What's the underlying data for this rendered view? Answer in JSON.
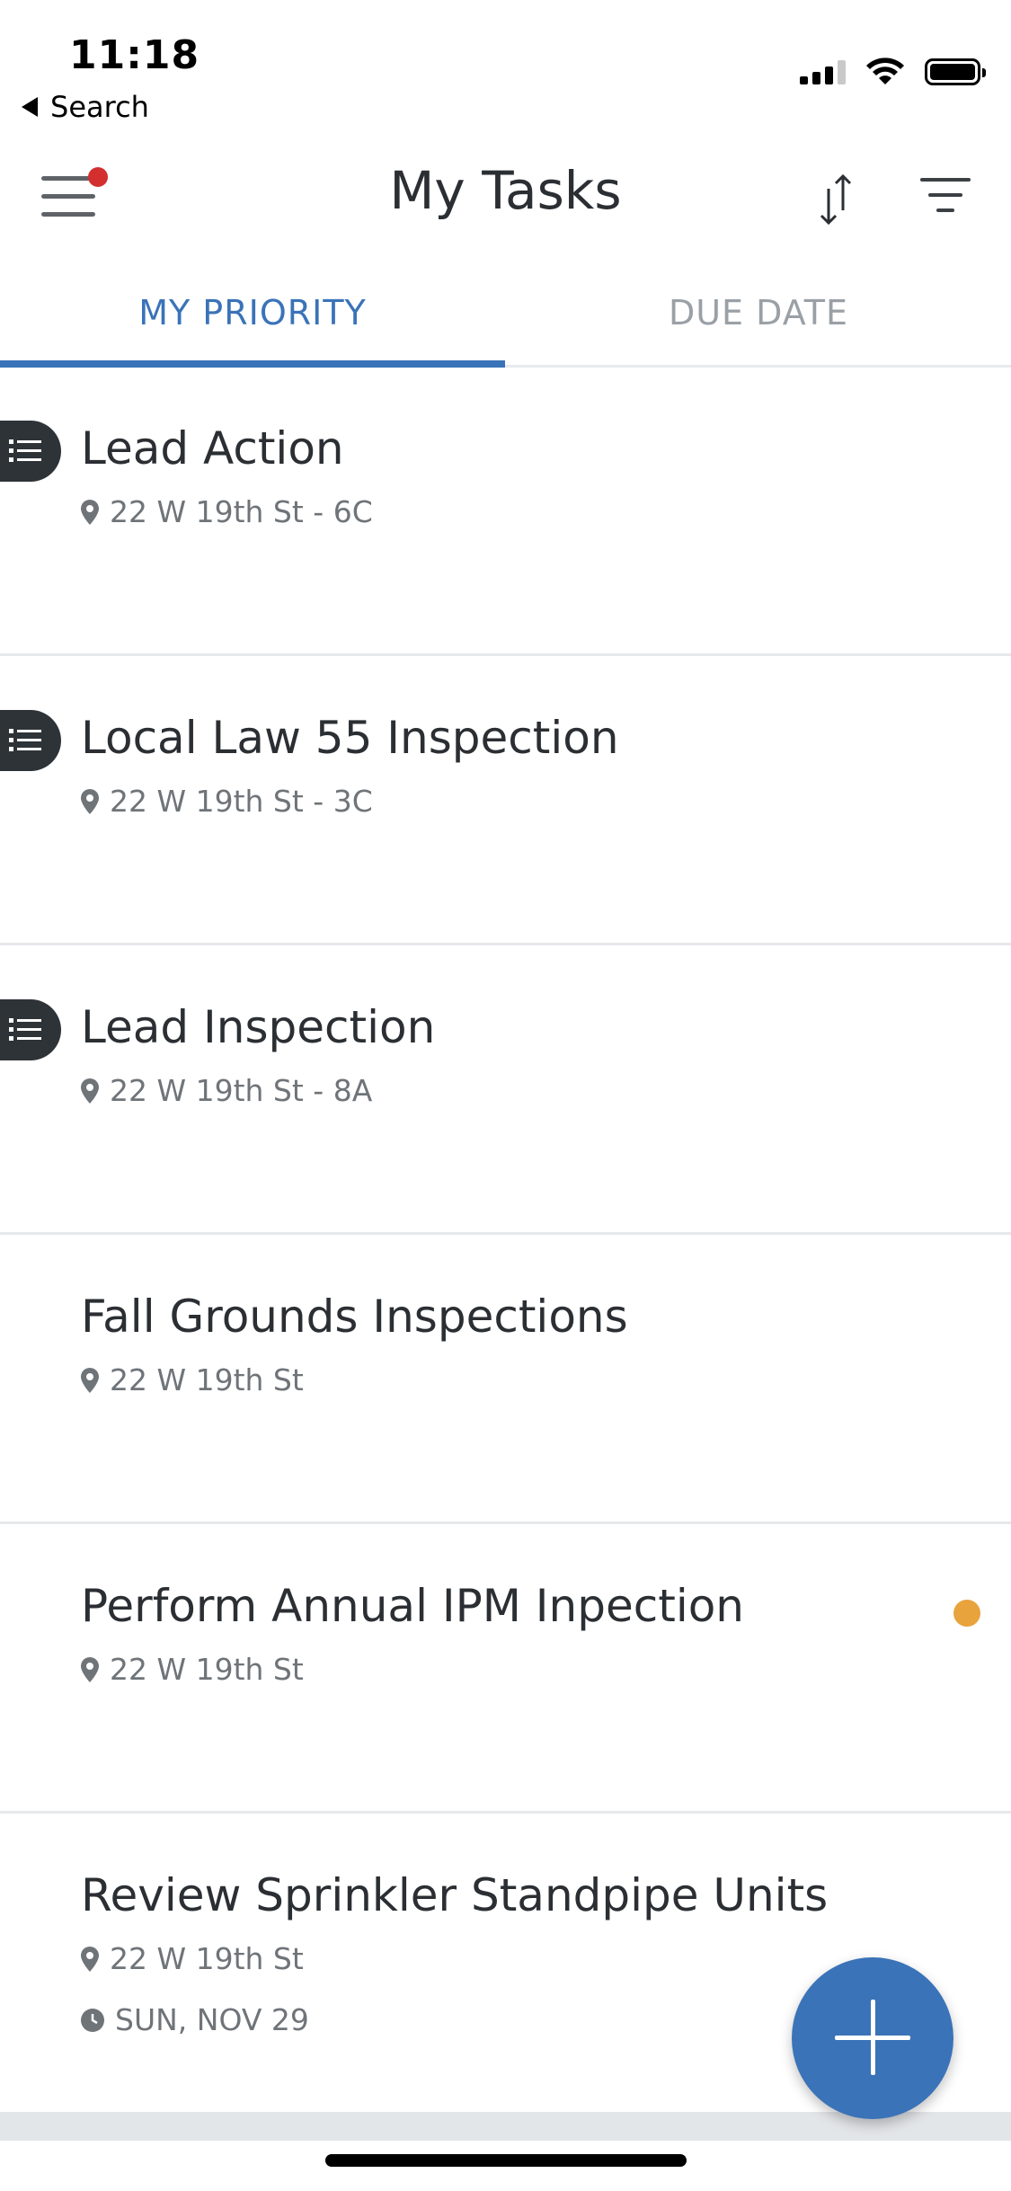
{
  "status_bar": {
    "time": "11:18",
    "back_label": "Search"
  },
  "header": {
    "title": "My Tasks",
    "menu_has_notification": true
  },
  "tabs": [
    {
      "label": "MY PRIORITY",
      "active": true
    },
    {
      "label": "DUE DATE",
      "active": false
    }
  ],
  "tasks": [
    {
      "title": "Lead Action",
      "address": "22 W 19th St - 6C",
      "has_checklist": true
    },
    {
      "title": "Local Law 55 Inspection",
      "address": "22 W 19th St - 3C",
      "has_checklist": true
    },
    {
      "title": "Lead Inspection",
      "address": "22 W 19th St - 8A",
      "has_checklist": true
    },
    {
      "title": "Fall Grounds Inspections",
      "address": "22 W 19th St",
      "has_checklist": false
    },
    {
      "title": "Perform Annual IPM Inpection",
      "address": "22 W 19th St",
      "has_checklist": false,
      "status_dot_color": "#e8a33d"
    },
    {
      "title": "Review Sprinkler Standpipe Units",
      "address": "22 W 19th St",
      "due_date": "SUN, NOV 29",
      "has_checklist": false
    }
  ],
  "colors": {
    "accent": "#3a73b8",
    "notification": "#d32f2f",
    "status_dot": "#e8a33d"
  },
  "icons": {
    "menu": "hamburger-icon",
    "sort": "sort-icon",
    "filter": "filter-icon",
    "checklist": "list-icon",
    "location": "map-pin-icon",
    "clock": "clock-icon",
    "add": "plus-icon"
  }
}
